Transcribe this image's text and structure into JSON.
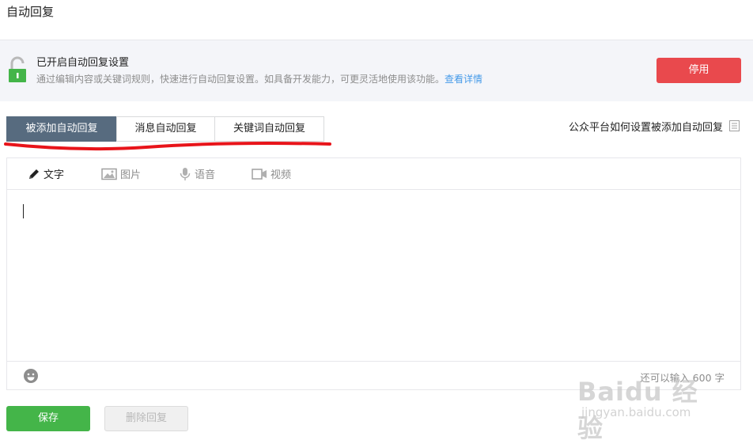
{
  "page": {
    "title": "自动回复"
  },
  "banner": {
    "title": "已开启自动回复设置",
    "description": "通过编辑内容或关键词规则，快速进行自动回复设置。如具备开发能力，可更灵活地使用该功能。",
    "link_label": "查看详情",
    "stop_button_label": "停用",
    "lock_icon": "unlocked-padlock-icon"
  },
  "tabs": [
    {
      "label": "被添加自动回复",
      "active": true
    },
    {
      "label": "消息自动回复",
      "active": false
    },
    {
      "label": "关键词自动回复",
      "active": false
    }
  ],
  "help_link": {
    "label": "公众平台如何设置被添加自动回复",
    "icon": "document-icon"
  },
  "editor": {
    "tools": [
      {
        "label": "文字",
        "icon": "pencil-icon",
        "active": true
      },
      {
        "label": "图片",
        "icon": "image-icon",
        "active": false
      },
      {
        "label": "语音",
        "icon": "microphone-icon",
        "active": false
      },
      {
        "label": "视频",
        "icon": "video-camera-icon",
        "active": false
      }
    ],
    "content": "",
    "char_count_text": "还可以输入 600 字",
    "emoji_icon": "smiley-icon"
  },
  "actions": {
    "save_label": "保存",
    "delete_label": "删除回复"
  },
  "watermark": {
    "logo": "Baidu 经验",
    "url": "jingyan.baidu.com"
  },
  "colors": {
    "accent_tab": "#576b7f",
    "stop_button": "#e9494d",
    "save_button": "#44b549",
    "link": "#459ae9",
    "lock": "#44b549",
    "annotation_underline": "#e8141a"
  }
}
